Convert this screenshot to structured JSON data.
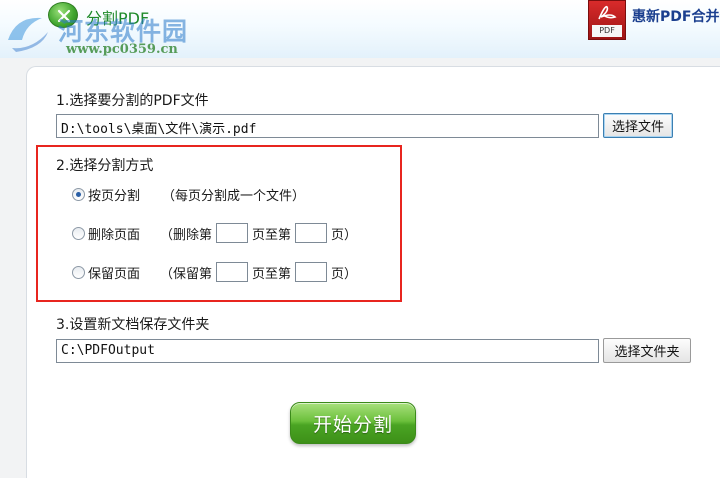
{
  "window": {
    "title": "分割PDF",
    "brand": "惠新PDF合并分",
    "pdf_logo_caption": "PDF"
  },
  "watermark": {
    "site_name": "河东软件园",
    "url": "www.pc0359.cn"
  },
  "step1": {
    "label": "1.选择要分割的PDF文件",
    "file_path": "D:\\tools\\桌面\\文件\\演示.pdf",
    "browse_button": "选择文件"
  },
  "step2": {
    "label": "2.选择分割方式",
    "options": [
      {
        "label": "按页分割",
        "note": "（每页分割成一个文件）",
        "checked": true
      },
      {
        "label": "删除页面",
        "prefix": "（删除第",
        "middle": "页至第",
        "suffix": "页）",
        "from": "",
        "to": "",
        "checked": false
      },
      {
        "label": "保留页面",
        "prefix": "（保留第",
        "middle": "页至第",
        "suffix": "页）",
        "from": "",
        "to": "",
        "checked": false
      }
    ]
  },
  "step3": {
    "label": "3.设置新文档保存文件夹",
    "folder_path": "C:\\PDFOutput",
    "browse_button": "选择文件夹"
  },
  "start_button": "开始分割",
  "colors": {
    "highlight_border": "#e8251f",
    "start_button": "#4aa423",
    "title_text": "#1f8a2a",
    "brand_text": "#1b3f8f"
  }
}
